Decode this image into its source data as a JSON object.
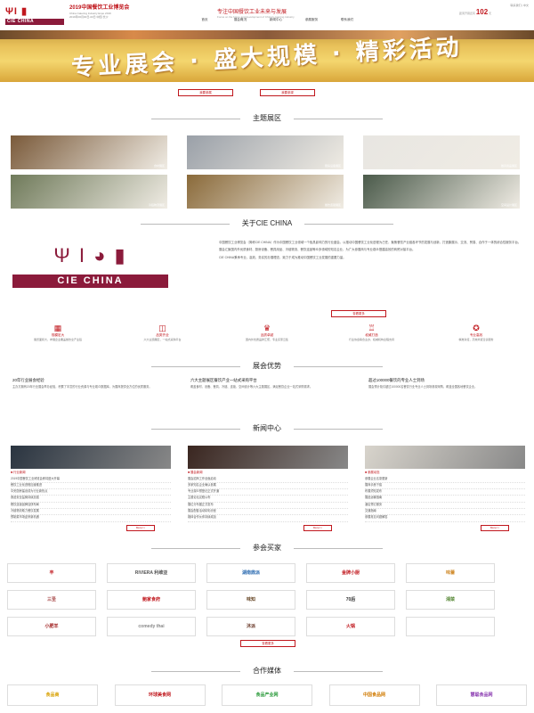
{
  "header": {
    "brand": "CIE CHINA",
    "title_cn": "2019中国餐饮工业博览会",
    "title_en": "China Catering Industry Expo 2019",
    "info": "2019年00月00日-00日 中国·长沙",
    "slogan": "专注中国餐饮工业未来与发展",
    "slogan_en": "Focus on the future and development of China's catering industry",
    "top_right": "联系我们 | 中文",
    "countdown_label": "距离开幕还有",
    "countdown_value": "102",
    "countdown_unit": "天"
  },
  "nav": [
    "首页",
    "展会概况",
    "新闻中心",
    "参展服务",
    "联系我们"
  ],
  "banner": {
    "text": "专业展会 · 盛大规模 · 精彩活动"
  },
  "hero_buttons": [
    "我要参展",
    "我要参观"
  ],
  "sections": {
    "theme": "主题展区",
    "about": "关于CIE CHINA",
    "advantages": "展会优势",
    "news": "新闻中心",
    "exhibitors": "参会买家",
    "media": "合作媒体"
  },
  "theme_cards": [
    {
      "caption": "食材展区",
      "color": "#7a5a3a"
    },
    {
      "caption": "厨房设备展区",
      "color": "#9aa0a8"
    },
    {
      "caption": "餐具用品展区",
      "color": "#e8e6e2"
    },
    {
      "caption": "冷链物流展区",
      "color": "#6f7a5a"
    },
    {
      "caption": "餐饮连锁展区",
      "color": "#8a6a3a"
    },
    {
      "caption": "空间设计展区",
      "color": "#4a5a4a"
    }
  ],
  "about": {
    "logo_text": "CIE CHINA",
    "paragraph1": "中国餐饮工业博览会（简称CIE CHINA）作为中国餐饮工业领域一个极具影响力的行业盛会，以推动中国餐饮工业化进程为己任，聚焦餐饮产业链各环节的发展与创新，打造集展示、交流、贸易、合作于一体的综合性服务平台。",
    "paragraph2": "展会汇聚国内外优质食材、厨房设备、餐具用品、冷链物流、餐饮连锁等众多领域的知名企业，为广大参展商与专业观众搭建高效的商贸对接平台。",
    "paragraph3": "CIE CHINA秉承专业、高效、务实的办展理念，致力于成为推动中国餐饮工业发展的重要力量。",
    "more": "查看更多"
  },
  "features": [
    {
      "icon": "▦",
      "label": "规模宏大",
      "desc": "展览面积大，参展企业覆盖餐饮全产业链"
    },
    {
      "icon": "◫",
      "label": "品类齐全",
      "desc": "六大主题展区，一站式采购平台"
    },
    {
      "icon": "♛",
      "label": "品质卓越",
      "desc": "国内外优质品牌汇聚，专业买家云集"
    },
    {
      "icon": "♖",
      "label": "权威打造",
      "desc": "行业协会联合主办，权威机构全程支持"
    },
    {
      "icon": "✪",
      "label": "专业高效",
      "desc": "精准对接，高效商贸洽谈服务"
    }
  ],
  "advantages": [
    {
      "title": "20年行业展会经验",
      "desc": "主办方拥有20年行业展会举办经验，积累了丰富的行业资源与专业观众数据库，为展商提供全方位的优质服务。"
    },
    {
      "title": "六大主题展区餐饮产业一站式采购平台",
      "desc": "覆盖食材、设备、餐具、冷链、连锁、空间设计等六大主题展区，满足餐饮企业一站式采购需求。"
    },
    {
      "title": "超过100000餐饮的专业人士到场",
      "desc": "展会预计吸引超过100000名餐饮行业专业人士到场参观采购，覆盖全国各地餐饮企业。"
    }
  ],
  "news": [
    {
      "category": "行业新闻",
      "img_color": "#2a3440",
      "items": [
        "2019中国餐饮工业博览会即将盛大开幕",
        "餐饮工业化进程加速推进",
        "中央厨房建设成为行业新热点",
        "食品安全监管持续加强",
        "餐饮连锁品牌加快布局",
        "冷链物流助力餐饮发展",
        "预制菜市场迎来新机遇"
      ],
      "more": "More>>"
    },
    {
      "category": "展会新闻",
      "img_color": "#3a2620",
      "items": [
        "展会招商工作全面启动",
        "多家知名企业确认参展",
        "专业观众预登记正式开通",
        "主题论坛议程公布",
        "展位分布图正式发布",
        "展会配套活动精彩纷呈",
        "媒体合作伙伴持续增加"
      ],
      "more": "More>>"
    },
    {
      "category": "参展动态",
      "img_color": "#d8d4cc",
      "items": [
        "参展企业名录更新",
        "展商手册下载",
        "布展须知发布",
        "展品运输指南",
        "酒店预订服务",
        "交通指南",
        "参展常见问题解答"
      ],
      "more": "More>>"
    }
  ],
  "exhibitors": [
    {
      "name": "丰",
      "color": "#c0171d"
    },
    {
      "name": "RIVIERA 利维亚",
      "color": "#555"
    },
    {
      "name": "湖南鼎派",
      "color": "#2a6ab0"
    },
    {
      "name": "金牌小厨",
      "color": "#c0171d"
    },
    {
      "name": "味蕾",
      "color": "#d08a2a"
    },
    {
      "name": "三圣",
      "color": "#a03a3a"
    },
    {
      "name": "鲍家食府",
      "color": "#c0171d"
    },
    {
      "name": "味知",
      "color": "#6a4a2a"
    },
    {
      "name": "70后",
      "color": "#333"
    },
    {
      "name": "湘菜",
      "color": "#5a8a3a"
    },
    {
      "name": "小肥羊",
      "color": "#a02020"
    },
    {
      "name": "comedy thai",
      "color": "#888"
    },
    {
      "name": "沐派",
      "color": "#6a3a2a"
    },
    {
      "name": "火锅",
      "color": "#c0171d"
    },
    {
      "name": "",
      "color": "#ccc"
    }
  ],
  "exhibitors_more": "查看更多",
  "media": [
    {
      "name": "食品商",
      "color": "#d8a000"
    },
    {
      "name": "环球美食网",
      "color": "#c0171d"
    },
    {
      "name": "食品产业网",
      "color": "#2a9a3a"
    },
    {
      "name": "中国食品网",
      "color": "#d07a00"
    },
    {
      "name": "慧聪食品网",
      "color": "#8a3ab0"
    }
  ]
}
